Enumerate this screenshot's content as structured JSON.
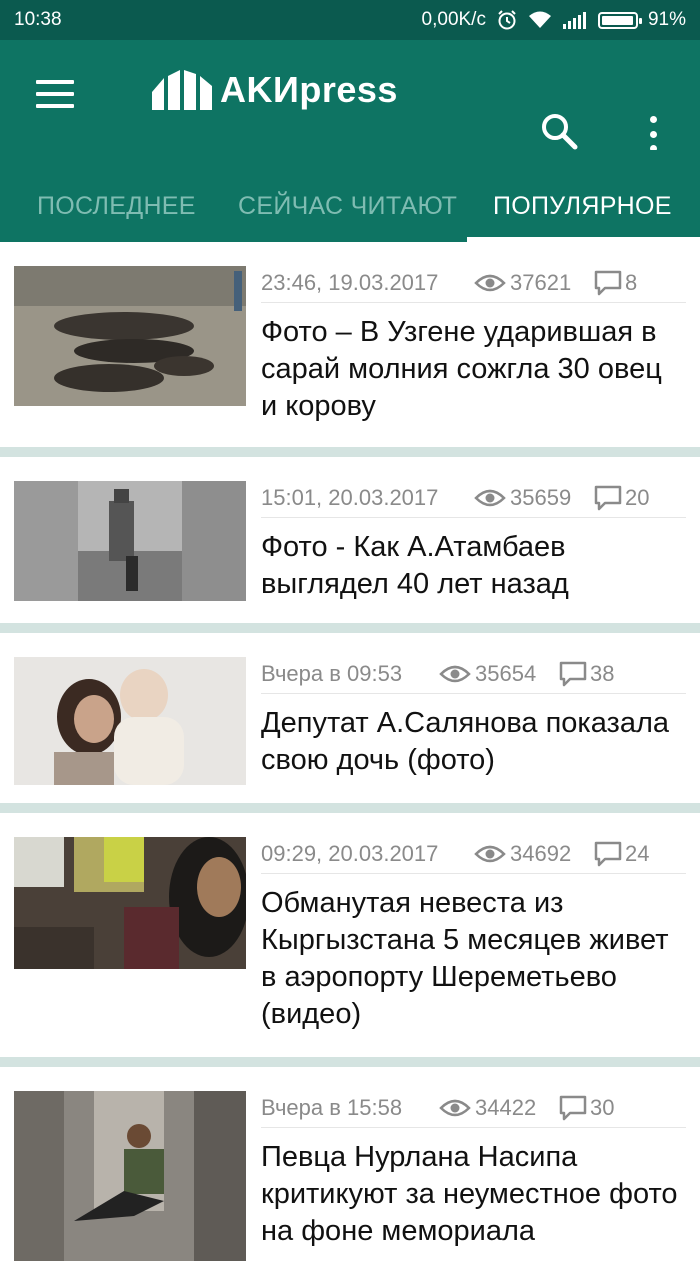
{
  "status_bar": {
    "time": "10:38",
    "net_speed": "0,00K/c",
    "battery": "91%",
    "icons": [
      "alarm-icon",
      "wifi-icon",
      "signal-icon",
      "battery-icon"
    ]
  },
  "app_bar": {
    "logo_text": "AKИpress",
    "icons": [
      "menu-icon",
      "search-icon",
      "more-vert-icon"
    ]
  },
  "tabs": [
    {
      "label": "ПОСЛЕДНЕЕ",
      "active": false
    },
    {
      "label": "СЕЙЧАС ЧИТАЮТ",
      "active": false
    },
    {
      "label": "ПОПУЛЯРНОЕ",
      "active": true
    }
  ],
  "articles": [
    {
      "date": "23:46, 19.03.2017",
      "views": "37621",
      "comments": "8",
      "title": "Фото – В Узгене ударившая в сарай молния сожгла 30 овец и корову"
    },
    {
      "date": "15:01, 20.03.2017",
      "views": "35659",
      "comments": "20",
      "title": "Фото - Как А.Атамбаев выглядел 40 лет назад"
    },
    {
      "date": "Вчера в 09:53",
      "views": "35654",
      "comments": "38",
      "title": "Депутат А.Салянова показала свою дочь (фото)"
    },
    {
      "date": "09:29, 20.03.2017",
      "views": "34692",
      "comments": "24",
      "title": "Обманутая невеста из Кыргызстана 5 месяцев живет в аэропорту Шереметьево (видео)"
    },
    {
      "date": "Вчера в 15:58",
      "views": "34422",
      "comments": "30",
      "title": "Певца Нурлана Насипа критикуют за неуместное фото на фоне мемориала"
    }
  ],
  "colors": {
    "status_bar": "#0b5a4f",
    "app_bar": "#0e7463",
    "tab_inactive": "#7fbcb2",
    "tab_active": "#ffffff",
    "divider": "#d3e3e0"
  }
}
